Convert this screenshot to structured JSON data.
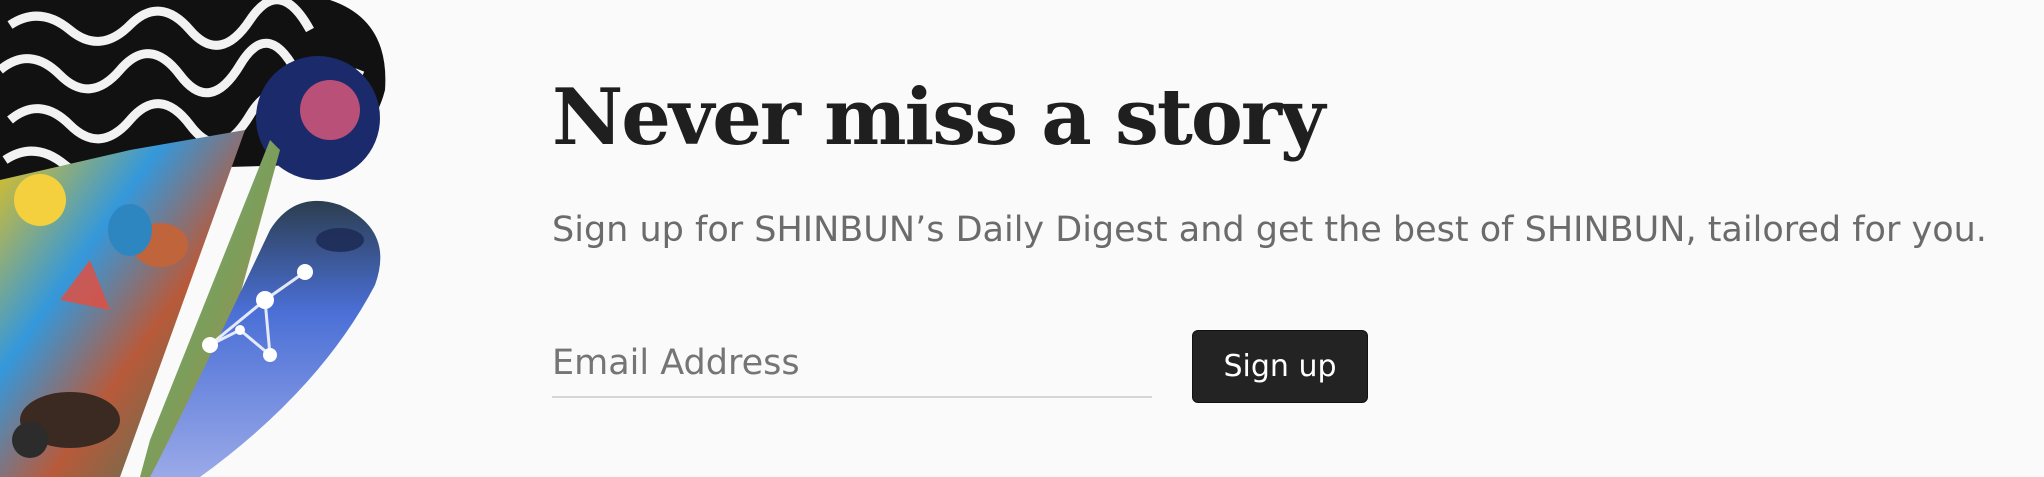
{
  "hero": {
    "title": "Never miss a story",
    "subtitle": "Sign up for SHINBUN’s Daily Digest and get the best of SHINBUN, tailored for you."
  },
  "form": {
    "email_placeholder": "Email Address",
    "email_value": "",
    "submit_label": "Sign up"
  },
  "colors": {
    "background": "#fafafa",
    "title": "#1f1f1f",
    "subtitle": "#6b6b6b",
    "button_bg": "#232323",
    "button_text": "#ffffff",
    "input_underline": "#d6d6d6"
  },
  "decoration": {
    "icon": "collage-artwork"
  }
}
